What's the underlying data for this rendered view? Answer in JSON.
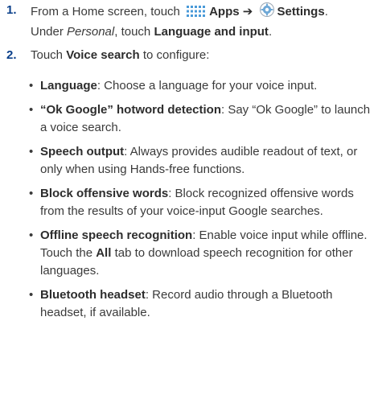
{
  "step1": {
    "num": "1.",
    "lead": "From a Home screen, touch",
    "apps": "Apps",
    "arrow": "➔",
    "settings": "Settings",
    "end": ".",
    "line2a": "Under",
    "personal": "Personal",
    "line2b": ", touch",
    "lang": "Language and input",
    "line2c": "."
  },
  "step2": {
    "num": "2.",
    "lead": "Touch",
    "voice": "Voice search",
    "tail": "to configure:"
  },
  "bullets": [
    {
      "term": "Language",
      "desc": ": Choose a language for your voice input."
    },
    {
      "term": "“Ok Google” hotword detection",
      "desc": ": Say “Ok Google” to launch a voice search."
    },
    {
      "term": "Speech output",
      "desc": ": Always provides audible readout of text, or only when using Hands-free functions."
    },
    {
      "term": "Block offensive words",
      "desc": ": Block recognized offensive words from the results of your voice-input Google searches."
    },
    {
      "term": "Offline speech recognition",
      "desc_a": ": Enable voice input while offline. Touch the",
      "all": "All",
      "desc_b": "tab to download speech recognition for other languages."
    },
    {
      "term": "Bluetooth headset",
      "desc": ": Record audio through a Bluetooth headset, if available."
    }
  ],
  "icons": {
    "apps": "apps-grid-icon",
    "settings": "settings-gear-icon"
  }
}
